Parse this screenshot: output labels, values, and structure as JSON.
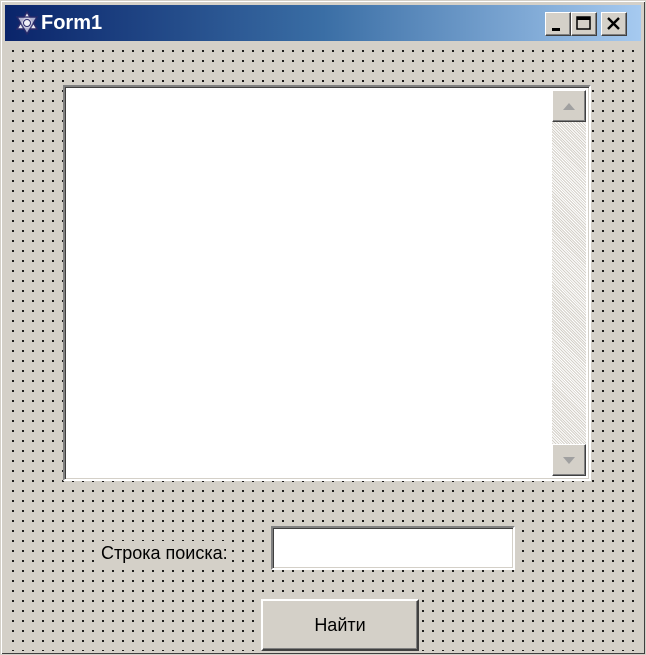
{
  "window": {
    "title": "Form1",
    "icon": "star-of-david-icon",
    "controls": [
      "minimize-icon",
      "maximize-icon",
      "close-icon"
    ]
  },
  "memo": {
    "value": "",
    "scrollbar": {
      "up_icon": "arrow-up-icon",
      "down_icon": "arrow-down-icon"
    }
  },
  "search": {
    "label": "Строка поиска:",
    "value": ""
  },
  "find_button": {
    "label": "Найти"
  },
  "colors": {
    "face": "#d4d0c8",
    "title_start": "#0a246a",
    "title_end": "#a6caf0",
    "field": "#ffffff"
  }
}
